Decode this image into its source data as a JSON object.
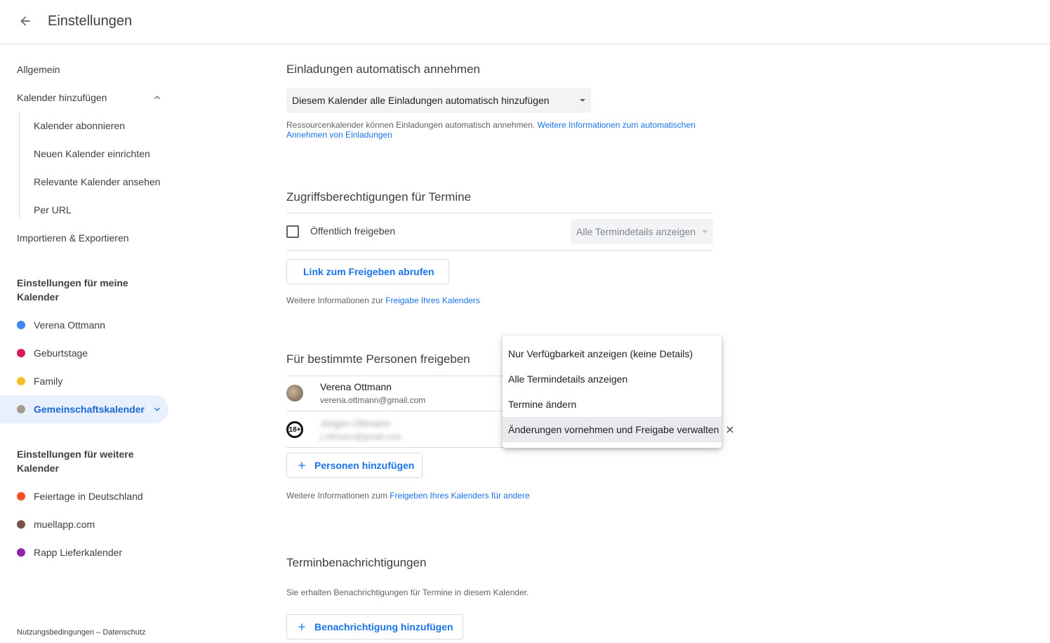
{
  "header": {
    "title": "Einstellungen"
  },
  "sidebar": {
    "general": "Allgemein",
    "add_calendar": "Kalender hinzufügen",
    "sub_items": [
      "Kalender abonnieren",
      "Neuen Kalender einrichten",
      "Relevante Kalender ansehen",
      "Per URL"
    ],
    "import_export": "Importieren & Exportieren",
    "my_calendars_heading": "Einstellungen für meine Kalender",
    "my_calendars": [
      {
        "name": "Verena Ottmann",
        "color": "#4285f4"
      },
      {
        "name": "Geburtstage",
        "color": "#d81b60"
      },
      {
        "name": "Family",
        "color": "#f6bf26"
      },
      {
        "name": "Gemeinschaftskalender",
        "color": "#a79b8e"
      }
    ],
    "other_calendars_heading": "Einstellungen für weitere Kalender",
    "other_calendars": [
      {
        "name": "Feiertage in Deutschland",
        "color": "#f4511e"
      },
      {
        "name": "muellapp.com",
        "color": "#795548"
      },
      {
        "name": "Rapp Lieferkalender",
        "color": "#8e24aa"
      }
    ],
    "footer": "Nutzungsbedingungen – Datenschutz"
  },
  "invites": {
    "heading": "Einladungen automatisch annehmen",
    "select_value": "Diesem Kalender alle Einladungen automatisch hinzufügen",
    "info_text": "Ressourcenkalender können Einladungen automatisch annehmen.",
    "info_link": "Weitere Informationen zum automatischen Annehmen von Einladungen"
  },
  "access": {
    "heading": "Zugriffsberechtigungen für Termine",
    "public_label": "Öffentlich freigeben",
    "public_select": "Alle Termindetails anzeigen",
    "link_button": "Link zum Freigeben abrufen",
    "info_text": "Weitere Informationen zur",
    "info_link": "Freigabe Ihres Kalenders"
  },
  "share": {
    "heading": "Für bestimmte Personen freigeben",
    "people": [
      {
        "name": "Verena Ottmann",
        "email": "verena.ottmann@gmail.com"
      },
      {
        "name": "Jürgen Ottmann",
        "email": "j.ottmann@gmail.com"
      }
    ],
    "add_button": "Personen hinzufügen",
    "info_text": "Weitere Informationen zum",
    "info_link": "Freigeben Ihres Kalenders für andere"
  },
  "menu": {
    "options": [
      "Nur Verfügbarkeit anzeigen (keine Details)",
      "Alle Termindetails anzeigen",
      "Termine ändern",
      "Änderungen vornehmen und Freigabe verwalten"
    ],
    "selected_index": 3
  },
  "notifications": {
    "heading": "Terminbenachrichtigungen",
    "info_text": "Sie erhalten Benachrichtigungen für Termine in diesem Kalender.",
    "add_button": "Benachrichtigung hinzufügen"
  }
}
